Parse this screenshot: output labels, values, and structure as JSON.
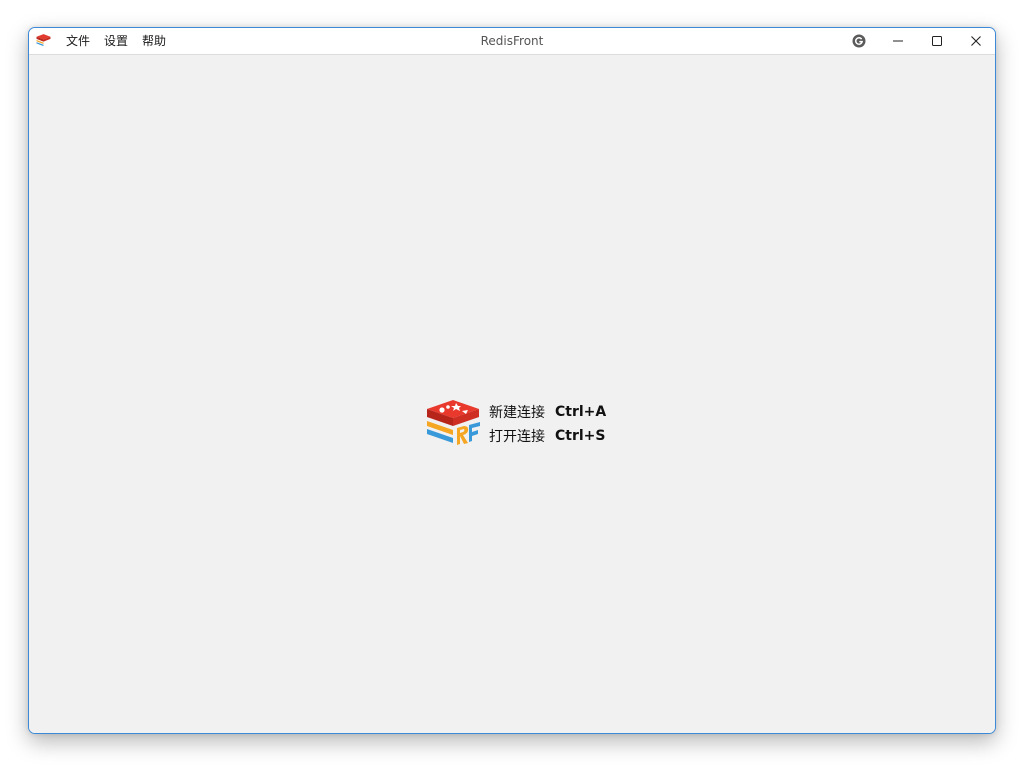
{
  "window": {
    "title": "RedisFront",
    "accent_color": "#3c8ad7",
    "background_color": "#f1f1f1"
  },
  "menubar": {
    "app_icon": "redisfront-logo-icon",
    "items": [
      {
        "label": "文件"
      },
      {
        "label": "设置"
      },
      {
        "label": "帮助"
      }
    ]
  },
  "title_controls": {
    "icons": [
      "github-icon",
      "minimize-icon",
      "maximize-icon",
      "close-icon"
    ]
  },
  "welcome": {
    "logo": "redisfront-logo-icon",
    "shortcuts": [
      {
        "label": "新建连接",
        "key": "Ctrl+A"
      },
      {
        "label": "打开连接",
        "key": "Ctrl+S"
      }
    ]
  }
}
